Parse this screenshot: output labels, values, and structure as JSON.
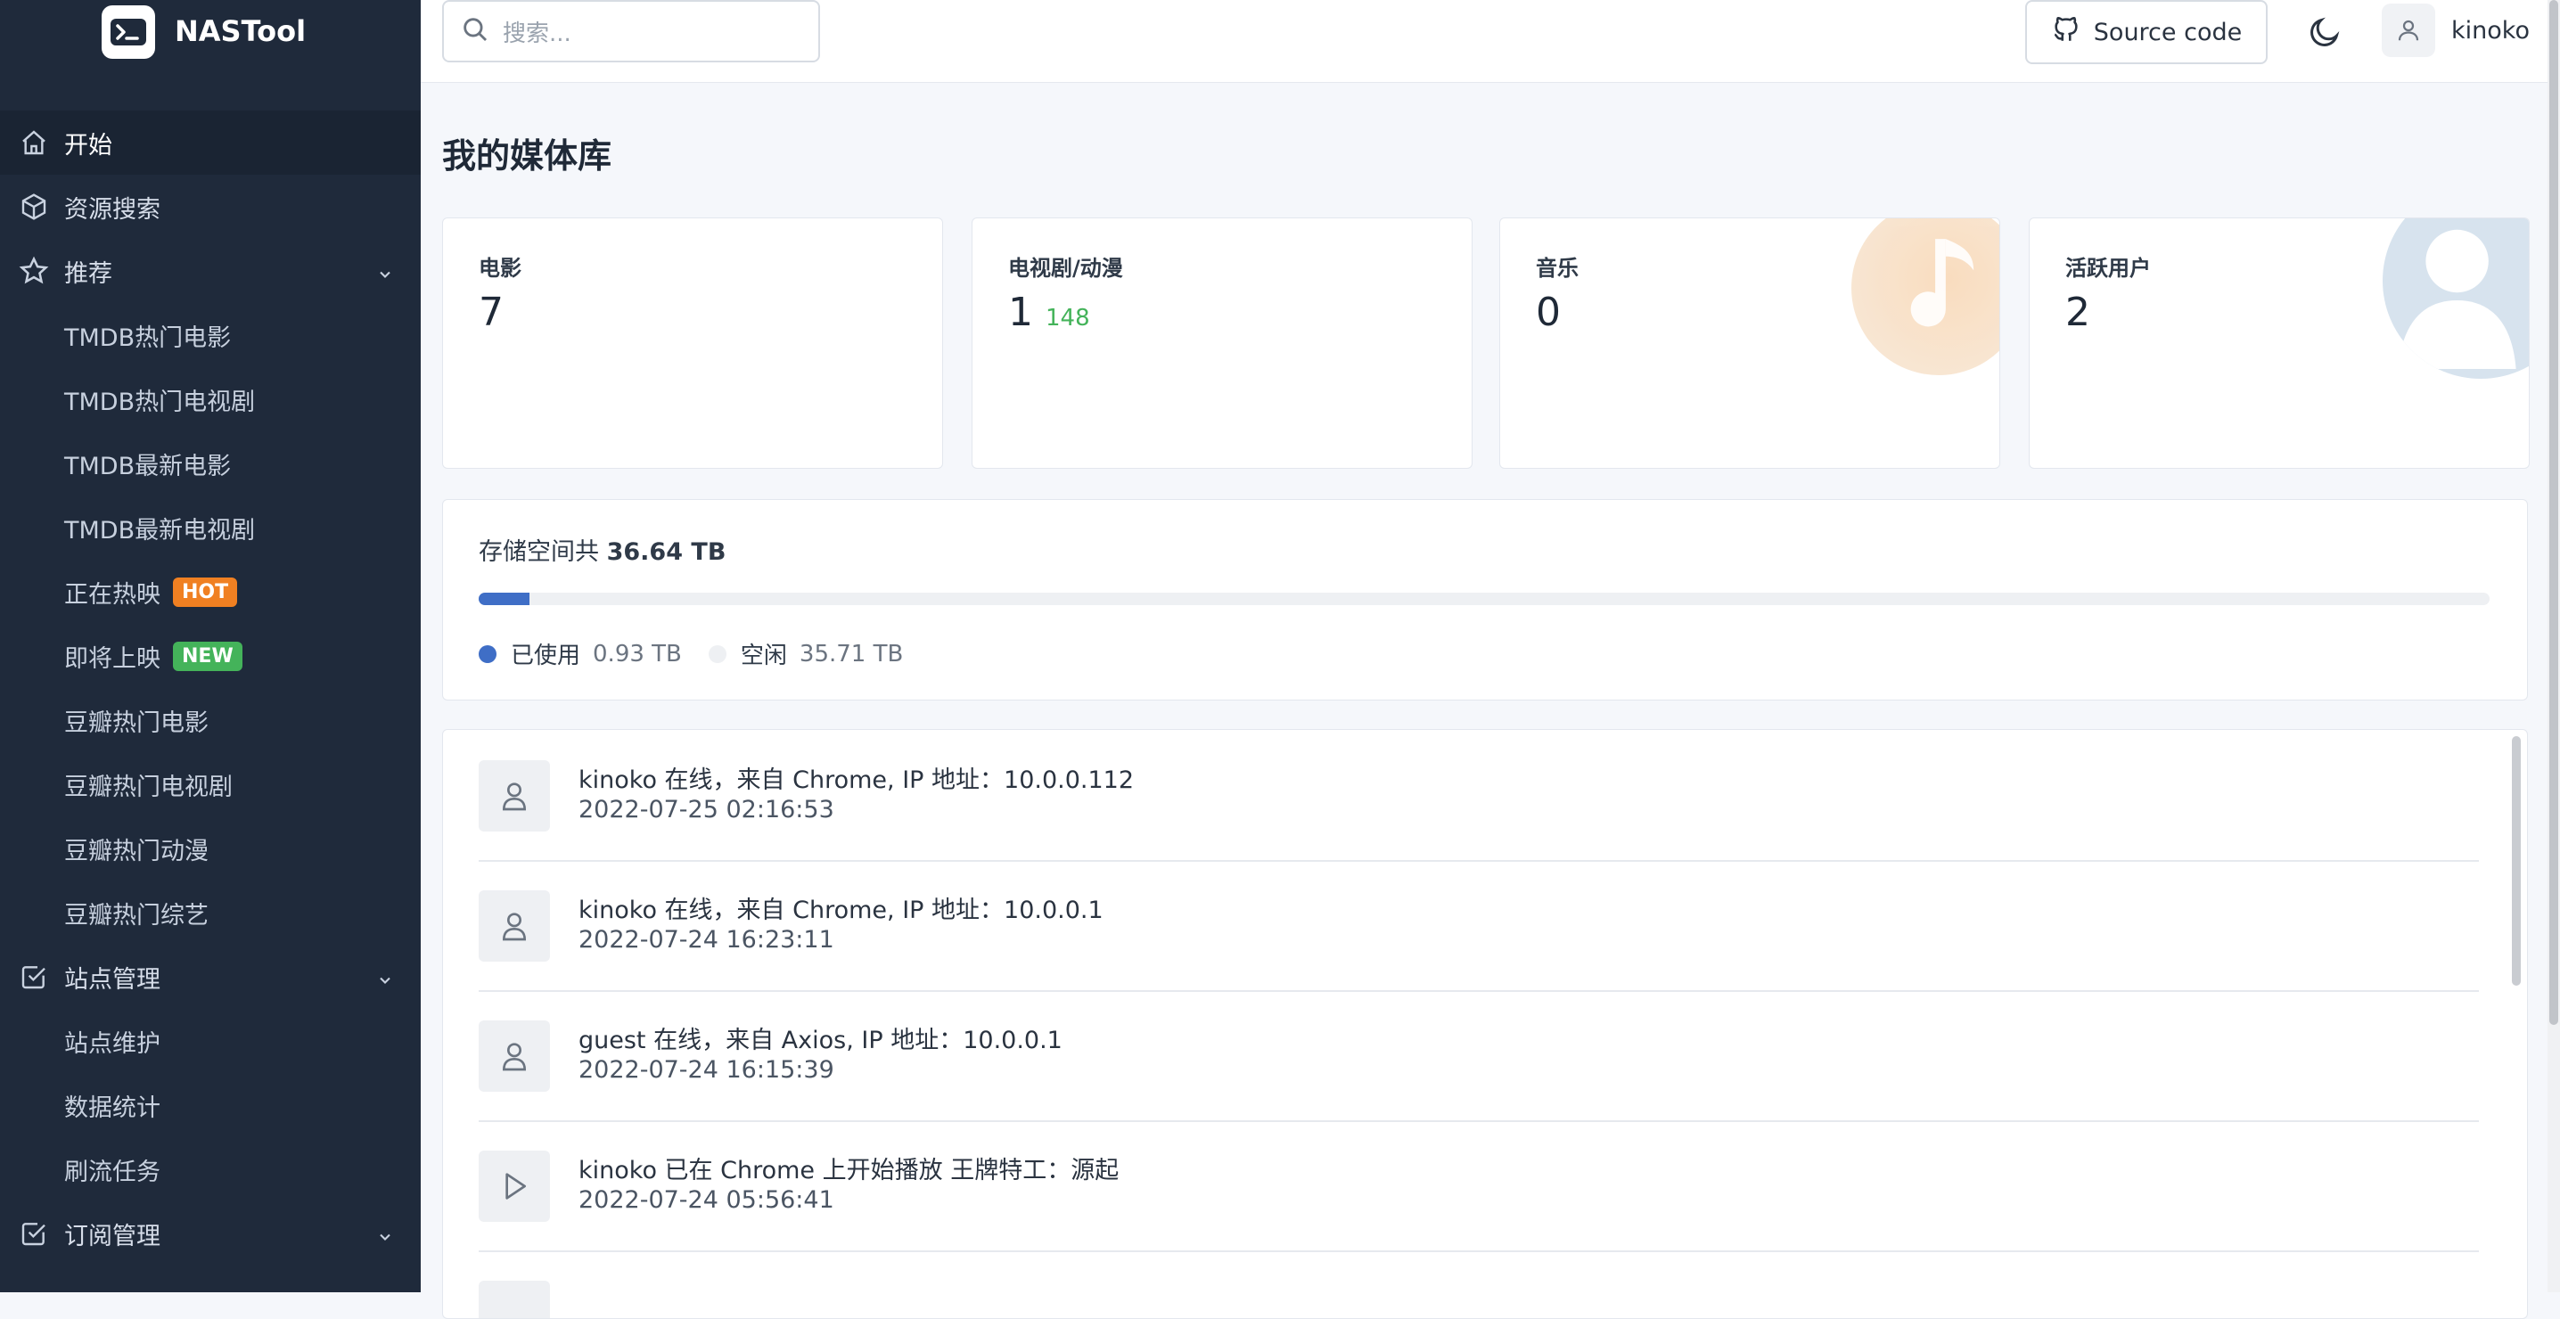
{
  "brand": {
    "title": "NASTool"
  },
  "sidebar": {
    "items": [
      {
        "label": "开始",
        "icon": "home-icon",
        "active": true
      },
      {
        "label": "资源搜索",
        "icon": "cube-icon"
      },
      {
        "label": "推荐",
        "icon": "star-icon",
        "expandable": true
      },
      {
        "label": "TMDB热门电影",
        "sub": true
      },
      {
        "label": "TMDB热门电视剧",
        "sub": true
      },
      {
        "label": "TMDB最新电影",
        "sub": true
      },
      {
        "label": "TMDB最新电视剧",
        "sub": true
      },
      {
        "label": "正在热映",
        "sub": true,
        "badge": "HOT"
      },
      {
        "label": "即将上映",
        "sub": true,
        "badge": "NEW"
      },
      {
        "label": "豆瓣热门电影",
        "sub": true
      },
      {
        "label": "豆瓣热门电视剧",
        "sub": true
      },
      {
        "label": "豆瓣热门动漫",
        "sub": true
      },
      {
        "label": "豆瓣热门综艺",
        "sub": true
      },
      {
        "label": "站点管理",
        "icon": "checkbox-icon",
        "expandable": true
      },
      {
        "label": "站点维护",
        "sub": true
      },
      {
        "label": "数据统计",
        "sub": true
      },
      {
        "label": "刷流任务",
        "sub": true
      },
      {
        "label": "订阅管理",
        "icon": "checkbox-icon",
        "expandable": true
      }
    ]
  },
  "header": {
    "search_placeholder": "搜索...",
    "source_code_label": "Source code",
    "username": "kinoko"
  },
  "main": {
    "title": "我的媒体库",
    "stats": [
      {
        "label": "电影",
        "value": "7",
        "extra": ""
      },
      {
        "label": "电视剧/动漫",
        "value": "1",
        "extra": "148"
      },
      {
        "label": "音乐",
        "value": "0",
        "extra": ""
      },
      {
        "label": "活跃用户",
        "value": "2",
        "extra": ""
      }
    ],
    "storage": {
      "title_prefix": "存储空间共",
      "total": "36.64 TB",
      "used_label": "已使用",
      "used_value": "0.93 TB",
      "free_label": "空闲",
      "free_value": "35.71 TB",
      "used_fraction": 0.0254
    },
    "activity": [
      {
        "icon": "user-icon",
        "text": "kinoko 在线，来自 Chrome, IP 地址：10.0.0.112",
        "time": "2022-07-25 02:16:53"
      },
      {
        "icon": "user-icon",
        "text": "kinoko 在线，来自 Chrome, IP 地址：10.0.0.1",
        "time": "2022-07-24 16:23:11"
      },
      {
        "icon": "user-icon",
        "text": "guest 在线，来自 Axios, IP 地址：10.0.0.1",
        "time": "2022-07-24 16:15:39"
      },
      {
        "icon": "play-icon",
        "text": "kinoko 已在 Chrome 上开始播放 王牌特工：源起",
        "time": "2022-07-24 05:56:41"
      }
    ]
  },
  "colors": {
    "sidebar_bg": "#1f2a3b",
    "accent": "#3f6ec6",
    "hot": "#f08022",
    "new": "#44b35a"
  }
}
